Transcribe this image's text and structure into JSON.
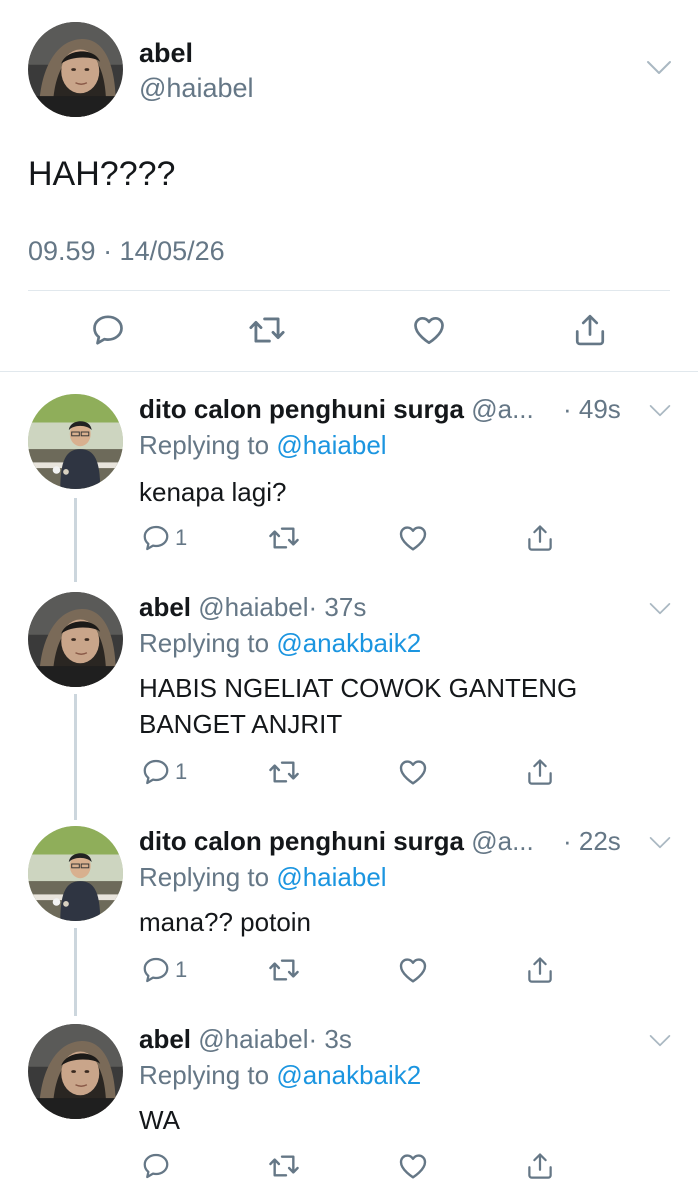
{
  "main_tweet": {
    "name": "abel",
    "handle": "@haiabel",
    "text": "HAH????",
    "timestamp": "09.59 · 14/05/26",
    "icons": [
      "reply-icon",
      "retweet-icon",
      "like-icon",
      "share-icon"
    ]
  },
  "replies": [
    {
      "name": "dito calon penghuni surga",
      "handle": "@a...",
      "time": "· 49s",
      "replying_prefix": "Replying to",
      "replying_to": "@haiabel",
      "text": "kenapa lagi?",
      "reply_count": "1"
    },
    {
      "name": "abel",
      "handle": "@haiabel",
      "time": "· 37s",
      "replying_prefix": "Replying to",
      "replying_to": "@anakbaik2",
      "text_line1": "HABIS NGELIAT COWOK GANTENG",
      "text_line2": "BANGET ANJRIT",
      "reply_count": "1"
    },
    {
      "name": "dito calon penghuni surga",
      "handle": "@a...",
      "time": "· 22s",
      "replying_prefix": "Replying to",
      "replying_to": "@haiabel",
      "text": "mana?? potoin",
      "reply_count": "1"
    },
    {
      "name": "abel",
      "handle": "@haiabel",
      "time": "· 3s",
      "replying_prefix": "Replying to",
      "replying_to": "@anakbaik2",
      "text": "WA",
      "reply_count": ""
    }
  ],
  "colors": {
    "text": "#14171a",
    "secondary": "#657786",
    "link": "#1b95e0",
    "divider": "#e1e8ed",
    "thread_line": "#ccd6dd"
  }
}
